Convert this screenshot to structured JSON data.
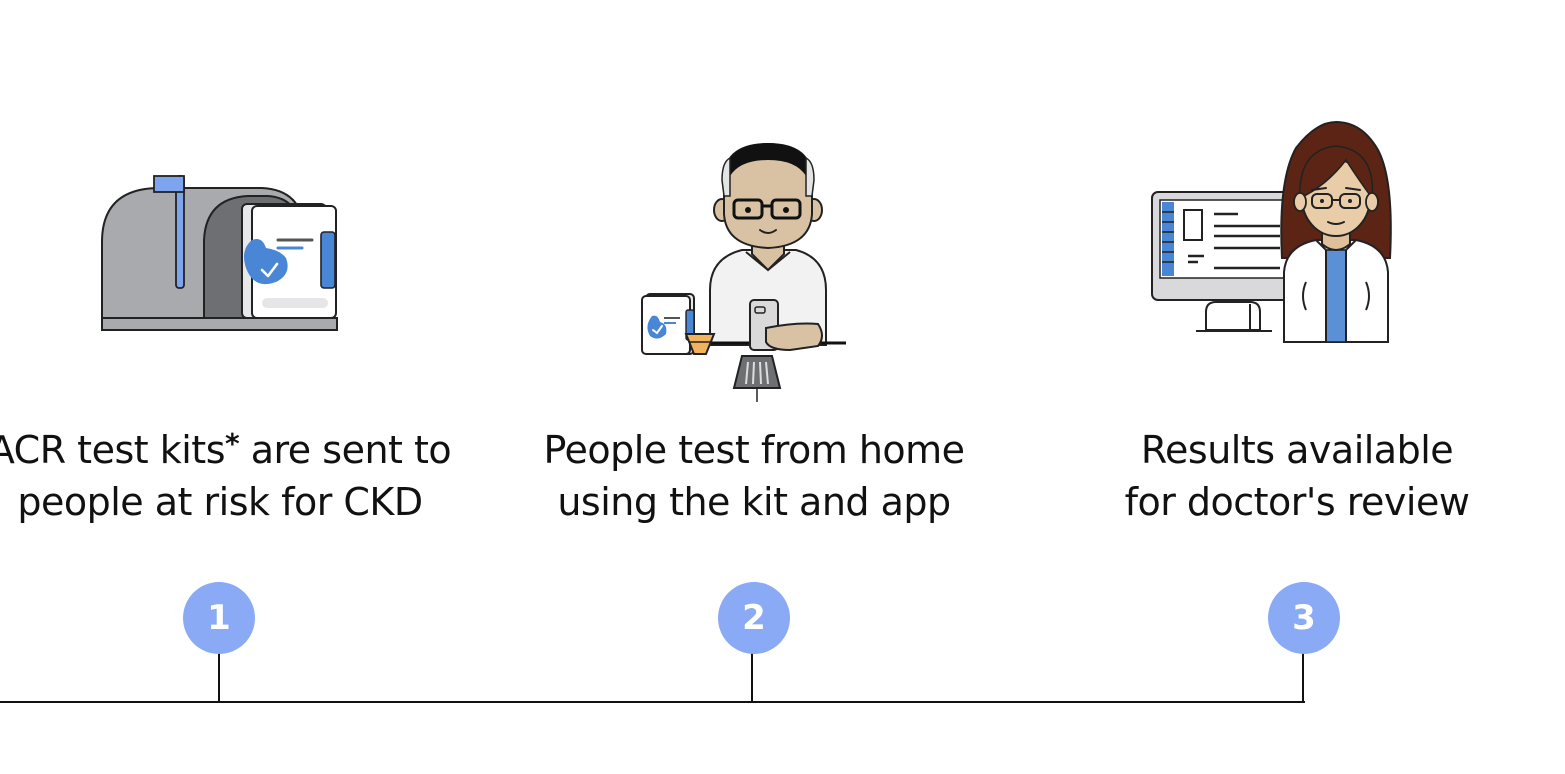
{
  "colors": {
    "step_circle": "#8aaaf6",
    "brand_blue": "#4a86d6",
    "line": "#111111"
  },
  "steps": [
    {
      "number": "1",
      "caption_line1_pre": "ACR test kits",
      "caption_mark": "*",
      "caption_line1_post": " are sent to",
      "caption_line2": "people at risk for CKD",
      "icon": "mailbox-with-kit-icon"
    },
    {
      "number": "2",
      "caption_line1": "People test from home",
      "caption_line2": "using the kit and app",
      "icon": "man-testing-with-phone-icon"
    },
    {
      "number": "3",
      "caption_line1": "Results available",
      "caption_line2": "for doctor's review",
      "icon": "doctor-with-monitor-icon"
    }
  ]
}
